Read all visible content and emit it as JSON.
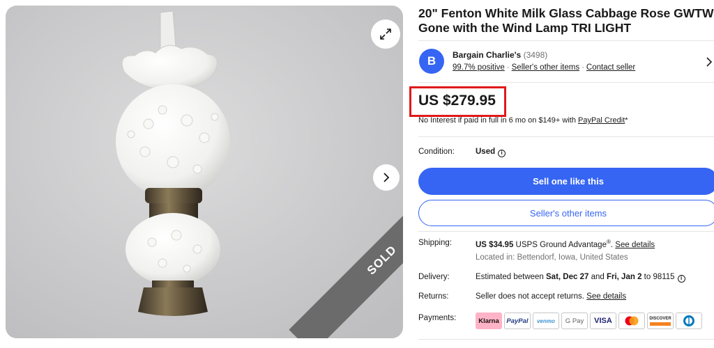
{
  "gallery": {
    "sold_label": "SOLD",
    "expand_icon": "expand-icon",
    "next_icon": "chevron-right-icon"
  },
  "listing": {
    "title": "20\" Fenton White Milk Glass Cabbage Rose GWTW Gone with the Wind Lamp TRI LIGHT"
  },
  "seller": {
    "avatar_letter": "B",
    "name": "Bargain Charlie's",
    "feedback_count": "(3498)",
    "positive": "99.7% positive",
    "other_items_link": "Seller's other items",
    "contact_link": "Contact seller",
    "separator": "·"
  },
  "price": {
    "value": "US $279.95",
    "financing_text": "No Interest if paid in full in 6 mo on $149+ with ",
    "financing_link": "PayPal Credit",
    "financing_suffix": "*"
  },
  "condition": {
    "label": "Condition:",
    "value": "Used",
    "info": "i"
  },
  "buttons": {
    "primary": "Sell one like this",
    "secondary": "Seller's other items"
  },
  "shipping": {
    "label": "Shipping:",
    "cost": "US $34.95",
    "method": " USPS Ground Advantage",
    "reg": "®",
    "period": ". ",
    "details_link": "See details",
    "location": "Located in: Bettendorf, Iowa, United States"
  },
  "delivery": {
    "label": "Delivery:",
    "prefix": "Estimated between ",
    "start": "Sat, Dec 27",
    "and": " and ",
    "end": "Fri, Jan 2",
    "suffix": " to 98115",
    "info": "i"
  },
  "returns": {
    "label": "Returns:",
    "text": "Seller does not accept returns. ",
    "details_link": "See details"
  },
  "payments": {
    "label": "Payments:",
    "methods": [
      "Klarna",
      "PayPal",
      "venmo",
      "G Pay",
      "VISA",
      "Mastercard",
      "DISCOVER",
      "Diners Club"
    ]
  },
  "colors": {
    "accent": "#3665f3",
    "highlight": "#e01919",
    "klarna": "#ffb3c7"
  }
}
